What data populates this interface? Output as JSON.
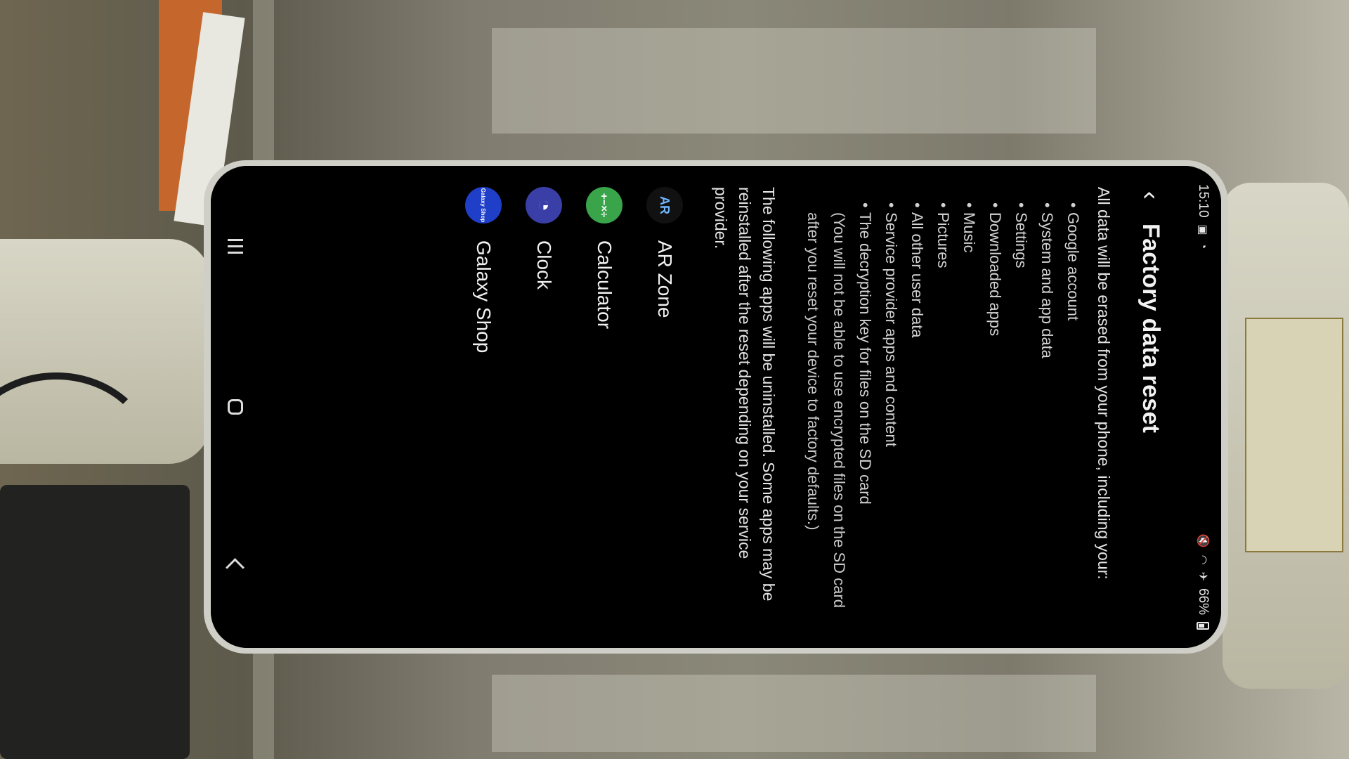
{
  "status_bar": {
    "time": "15:10",
    "battery": "66%"
  },
  "header": {
    "title": "Factory data reset"
  },
  "content": {
    "intro": "All data will be erased from your phone, including your:",
    "bullets": [
      "Google account",
      "System and app data",
      "Settings",
      "Downloaded apps",
      "Music",
      "Pictures",
      "All other user data",
      "Service provider apps and content",
      "The decryption key for files on the SD card"
    ],
    "note": "(You will not be able to use encrypted files on the SD card after you reset your device to factory defaults.)",
    "apps_intro": "The following apps will be uninstalled. Some apps may be reinstalled after the reset depending on your service provider.",
    "apps": [
      {
        "name": "AR Zone",
        "icon": "ar-zone-icon",
        "glyph": "AR",
        "color": "#111111",
        "glyph_color": "#6fb6ff"
      },
      {
        "name": "Calculator",
        "icon": "calculator-icon",
        "glyph": "+−×÷",
        "color": "#3aa44a",
        "glyph_color": "#ffffff"
      },
      {
        "name": "Clock",
        "icon": "clock-icon",
        "glyph": "◔",
        "color": "#3a3fa8",
        "glyph_color": "#ffffff"
      },
      {
        "name": "Galaxy Shop",
        "icon": "galaxy-shop-icon",
        "glyph": "Galaxy Shop",
        "color": "#1f3fc8",
        "glyph_color": "#ffffff"
      }
    ]
  }
}
